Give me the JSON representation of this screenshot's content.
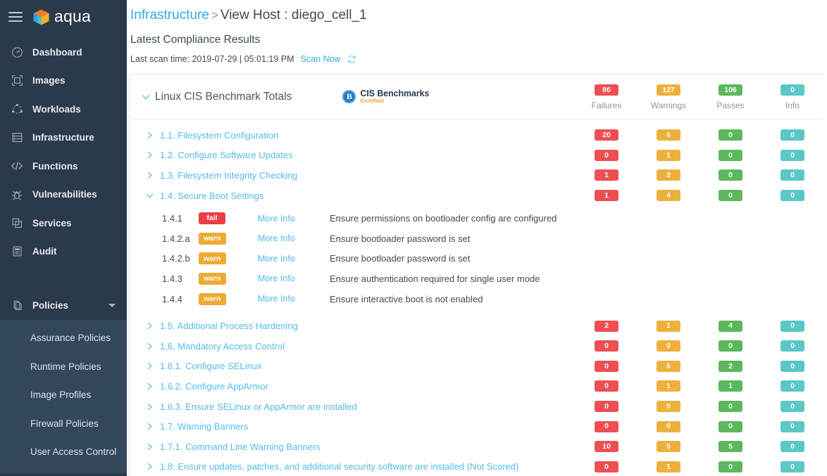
{
  "sidebar": {
    "brand": "aqua",
    "menu_icon": "hamburger-icon",
    "items": [
      {
        "label": "Dashboard",
        "icon": "speedometer-icon"
      },
      {
        "label": "Images",
        "icon": "image-frame-icon"
      },
      {
        "label": "Workloads",
        "icon": "workloads-icon"
      },
      {
        "label": "Infrastructure",
        "icon": "server-stack-icon"
      },
      {
        "label": "Functions",
        "icon": "code-brackets-icon"
      },
      {
        "label": "Vulnerabilities",
        "icon": "bug-icon"
      },
      {
        "label": "Services",
        "icon": "copy-layers-icon"
      },
      {
        "label": "Audit",
        "icon": "clipboard-icon"
      }
    ],
    "policies": {
      "label": "Policies",
      "icon": "documents-icon",
      "caret": "caret-down-icon",
      "children": [
        "Assurance Policies",
        "Runtime Policies",
        "Image Profiles",
        "Firewall Policies",
        "User Access Control"
      ]
    }
  },
  "header": {
    "breadcrumb_root": "Infrastructure",
    "breadcrumb_sep": ">",
    "breadcrumb_current": "View Host : diego_cell_1",
    "section_title": "Latest Compliance Results",
    "scan_label": "Last scan time: 2019-07-29 | 05:01:19 PM",
    "scan_now": "Scan Now",
    "refresh_icon": "refresh-icon"
  },
  "totals": {
    "title": "Linux CIS Benchmark Totals",
    "collapse_icon": "chevron-down-icon",
    "cis_logo": {
      "mark": "B",
      "main": "CIS Benchmarks",
      "sub": "Certified"
    },
    "columns": [
      {
        "label": "Failures",
        "value": "86",
        "kind": "fail"
      },
      {
        "label": "Warnings",
        "value": "127",
        "kind": "warn"
      },
      {
        "label": "Passes",
        "value": "106",
        "kind": "pass"
      },
      {
        "label": "Info",
        "value": "0",
        "kind": "info"
      }
    ]
  },
  "rows": [
    {
      "label": "1.1. Filesystem Configuration",
      "expanded": false,
      "values": [
        "20",
        "6",
        "0",
        "0"
      ]
    },
    {
      "label": "1.2. Configure Software Updates",
      "expanded": false,
      "values": [
        "0",
        "1",
        "0",
        "0"
      ]
    },
    {
      "label": "1.3. Filesystem Integrity Checking",
      "expanded": false,
      "values": [
        "1",
        "2",
        "0",
        "0"
      ]
    },
    {
      "label": "1.4. Secure Boot Settings",
      "expanded": true,
      "values": [
        "1",
        "4",
        "0",
        "0"
      ]
    },
    {
      "label": "1.5. Additional Process Hardening",
      "expanded": false,
      "values": [
        "2",
        "1",
        "4",
        "0"
      ]
    },
    {
      "label": "1.6. Mandatory Access Control",
      "expanded": false,
      "values": [
        "0",
        "0",
        "0",
        "0"
      ]
    },
    {
      "label": "1.6.1. Configure SELinux",
      "expanded": false,
      "values": [
        "0",
        "6",
        "2",
        "0"
      ]
    },
    {
      "label": "1.6.2. Configure AppArmor",
      "expanded": false,
      "values": [
        "0",
        "1",
        "1",
        "0"
      ]
    },
    {
      "label": "1.6.3. Ensure SELinux or AppArmor are installed",
      "expanded": false,
      "values": [
        "0",
        "0",
        "0",
        "0"
      ]
    },
    {
      "label": "1.7. Warning Banners",
      "expanded": false,
      "values": [
        "0",
        "0",
        "0",
        "0"
      ]
    },
    {
      "label": "1.7.1. Command Line Warning Banners",
      "expanded": false,
      "values": [
        "10",
        "5",
        "5",
        "0"
      ]
    },
    {
      "label": "1.8. Ensure updates, patches, and additional security software are installed (Not Scored)",
      "expanded": false,
      "values": [
        "0",
        "1",
        "0",
        "0"
      ]
    }
  ],
  "subrows": [
    {
      "id": "1.4.1",
      "status": "fail",
      "more_info": "More Info",
      "desc": "Ensure permissions on bootloader config are configured"
    },
    {
      "id": "1.4.2.a",
      "status": "warn",
      "more_info": "More Info",
      "desc": "Ensure bootloader password is set"
    },
    {
      "id": "1.4.2.b",
      "status": "warn",
      "more_info": "More Info",
      "desc": "Ensure bootloader password is set"
    },
    {
      "id": "1.4.3",
      "status": "warn",
      "more_info": "More Info",
      "desc": "Ensure authentication required for single user mode"
    },
    {
      "id": "1.4.4",
      "status": "warn",
      "more_info": "More Info",
      "desc": "Ensure interactive boot is not enabled"
    }
  ],
  "colors": {
    "sidebar_bg": "#2b3a4a",
    "submenu_bg": "#33475c",
    "link": "#35a9dd",
    "row_link": "#54bbe8",
    "fail": "#ed4f52",
    "warn": "#eeb03c",
    "pass": "#5cb85c",
    "info": "#5bc7c7"
  }
}
